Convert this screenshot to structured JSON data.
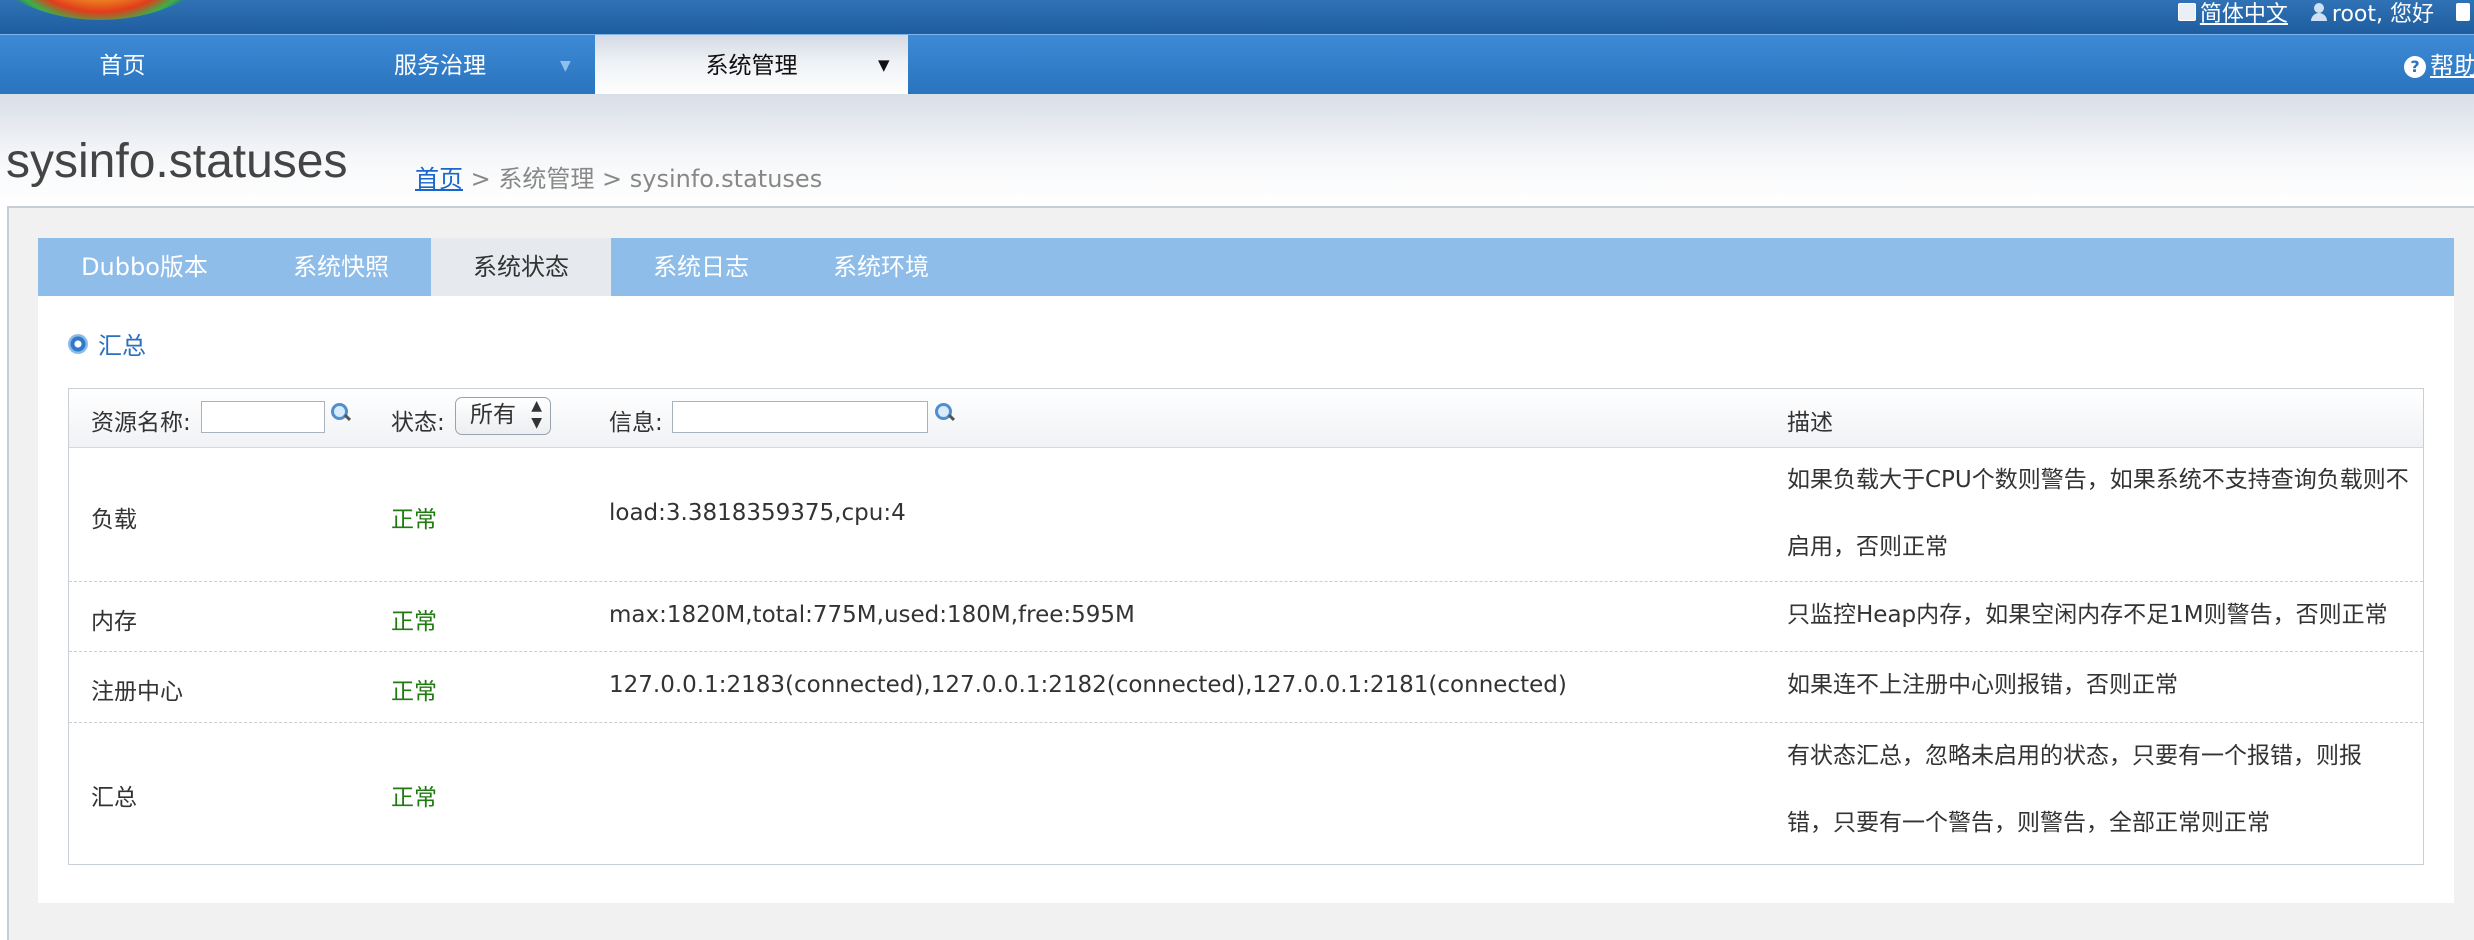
{
  "header": {
    "language": "简体中文",
    "greeting": "root, 您好"
  },
  "nav": {
    "home": "首页",
    "governance": "服务治理",
    "system": "系统管理",
    "help": "帮助"
  },
  "page": {
    "title": "sysinfo.statuses",
    "breadcrumb": {
      "home": "首页",
      "sep1": " > ",
      "system": "系统管理",
      "sep2": " > ",
      "current": "sysinfo.statuses"
    }
  },
  "tabs": [
    "Dubbo版本",
    "系统快照",
    "系统状态",
    "系统日志",
    "系统环境"
  ],
  "active_tab": "系统状态",
  "section": {
    "title": "汇总"
  },
  "table": {
    "headers": {
      "name": "资源名称:",
      "status": "状态:",
      "status_selected": "所有",
      "info": "信息:",
      "desc": "描述"
    },
    "rows": [
      {
        "name": "负载",
        "status": "正常",
        "info": "load:3.3818359375,cpu:4",
        "desc": "如果负载大于CPU个数则警告，如果系统不支持查询负载则不启用，否则正常"
      },
      {
        "name": "内存",
        "status": "正常",
        "info": "max:1820M,total:775M,used:180M,free:595M",
        "desc": "只监控Heap内存，如果空闲内存不足1M则警告，否则正常"
      },
      {
        "name": "注册中心",
        "status": "正常",
        "info": "127.0.0.1:2183(connected),127.0.0.1:2182(connected),127.0.0.1:2181(connected)",
        "desc": "如果连不上注册中心则报错，否则正常"
      },
      {
        "name": "汇总",
        "status": "正常",
        "info": "",
        "desc": "有状态汇总，忽略未启用的状态，只要有一个报错，则报错，只要有一个警告，则警告，全部正常则正常"
      }
    ]
  },
  "colors": {
    "nav_bg": "#2a73bd",
    "tab_bg": "#8fbde9",
    "ok": "#1f7a10",
    "link": "#1a66cc"
  }
}
